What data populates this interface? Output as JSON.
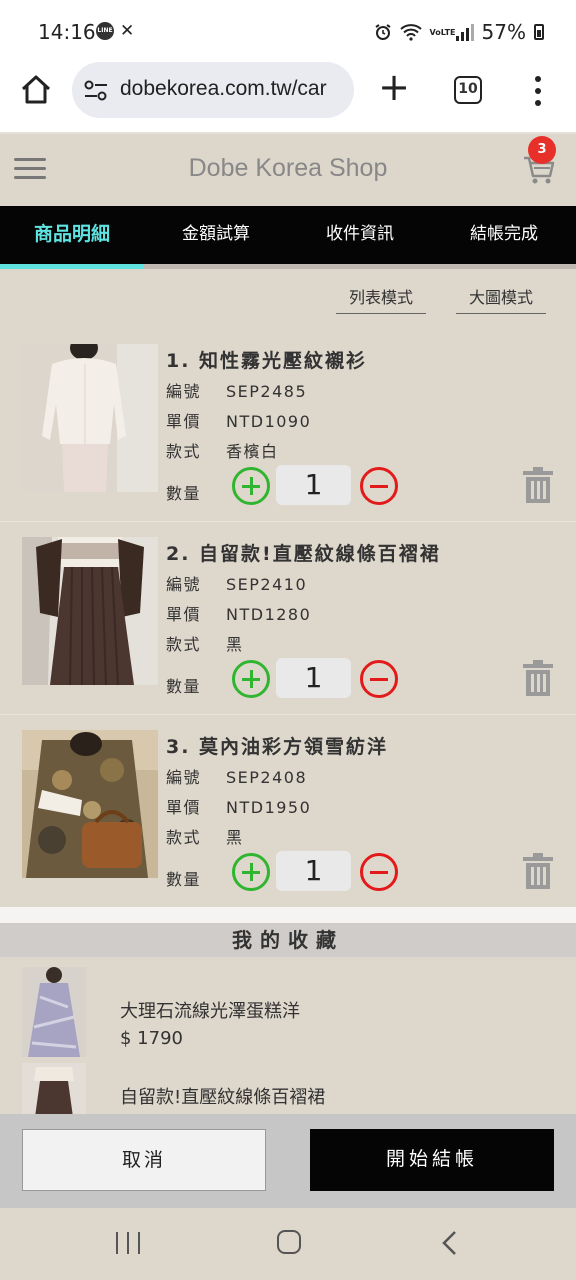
{
  "status_bar": {
    "time": "14:16",
    "left_icons": [
      "line-icon",
      "x-icon"
    ],
    "right_icons": [
      "alarm-icon",
      "wifi-icon",
      "volte-icon",
      "signal-icon",
      "battery-icon"
    ],
    "volte_label": "VoLTE",
    "battery": "57%"
  },
  "browser": {
    "url": "dobekorea.com.tw/car",
    "tab_count": "10",
    "icons": [
      "home-icon",
      "tune-icon",
      "plus-icon",
      "tabs-icon",
      "more-icon"
    ]
  },
  "header": {
    "title": "Dobe Korea Shop",
    "cart_count": "3",
    "icons": [
      "menu-icon",
      "cart-icon"
    ]
  },
  "steps": {
    "items": [
      "商品明細",
      "金額試算",
      "收件資訊",
      "結帳完成"
    ],
    "active_index": 0,
    "accent_color": "#5fe3e0"
  },
  "view_modes": {
    "list": "列表模式",
    "large": "大圖模式"
  },
  "labels": {
    "code": "編號",
    "price": "單價",
    "style": "款式",
    "quantity": "數量"
  },
  "cart_items": [
    {
      "title": "1. 知性霧光壓紋襯衫",
      "code": "SEP2485",
      "price": "NTD1090",
      "style": "香檳白",
      "qty": "1"
    },
    {
      "title": "2. 自留款!直壓紋線條百褶裙",
      "code": "SEP2410",
      "price": "NTD1280",
      "style": "黑",
      "qty": "1"
    },
    {
      "title": "3. 莫內油彩方領雪紡洋",
      "code": "SEP2408",
      "price": "NTD1950",
      "style": "黑",
      "qty": "1"
    }
  ],
  "favorites": {
    "header": "我的收藏",
    "items": [
      {
        "name": "大理石流線光澤蛋糕洋",
        "price": "$ 1790"
      },
      {
        "name": "自留款!直壓紋線條百褶裙"
      }
    ]
  },
  "actions": {
    "cancel": "取消",
    "checkout": "開始結帳"
  },
  "colors": {
    "page_bg": "#ded7cc",
    "plus": "#2fb52f",
    "minus": "#e31a1a",
    "badge": "#e8302a"
  }
}
